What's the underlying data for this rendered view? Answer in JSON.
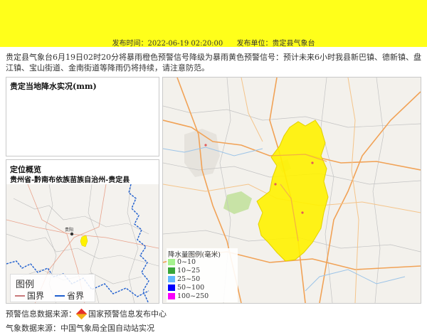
{
  "banner": {
    "publish_time": "发布时间：2022-06-19 02:20:00",
    "publisher": "发布单位：贵定县气象台",
    "color": "#ffff1a"
  },
  "notice": "贵定县气象台6月19日02时20分将暴雨橙色预警信号降级为暴雨黄色预警信号：预计未来6小时我县新巴镇、德新镇、盘江镇、宝山街道、金南街道等降雨仍将持续，请注意防范。",
  "rain_panel": {
    "title": "贵定当地降水实况(mm)"
  },
  "location": {
    "title": "定位概览",
    "path": "贵州省-黔南布依族苗族自治州-贵定县",
    "city_label": "贵阳",
    "legend": {
      "title": "图例",
      "items": [
        {
          "label": "国界",
          "color": "#c9787a"
        },
        {
          "label": "省界",
          "color": "#1f5fcf"
        }
      ]
    }
  },
  "map": {
    "warning_color": "#fff200",
    "precip_legend": {
      "title": "降水量图例(毫米)",
      "items": [
        {
          "label": "0~10",
          "color": "#a5f28e"
        },
        {
          "label": "10~25",
          "color": "#3aa63a"
        },
        {
          "label": "25~50",
          "color": "#63b8ff"
        },
        {
          "label": "50~100",
          "color": "#0000fe"
        },
        {
          "label": "100~250",
          "color": "#fa00fa"
        }
      ]
    }
  },
  "footer": {
    "source_label": "预警信息数据来源：",
    "source_name": "国家预警信息发布中心",
    "obs_label": "气象数据来源：中国气象局全国自动站实况"
  }
}
